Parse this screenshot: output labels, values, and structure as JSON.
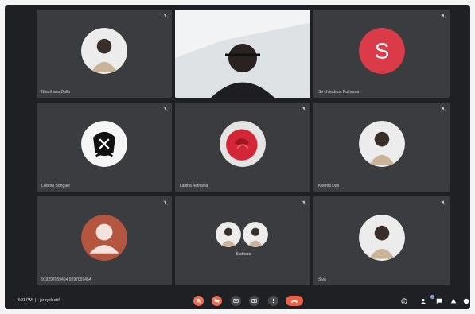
{
  "meeting": {
    "time": "3:01 PM",
    "code": "jsr-ryck-abf"
  },
  "participants": [
    {
      "name": "Bharthana Dalla",
      "avatar": "profile-photo",
      "muted": true
    },
    {
      "name": "",
      "avatar": "live-video",
      "muted": false
    },
    {
      "name": "Sri chandana Pathrana",
      "avatar": "letter",
      "letter": "S",
      "avatar_color": "#d93b48",
      "muted": true
    },
    {
      "name": "Lokesh Bongale",
      "avatar": "logo-photo",
      "muted": true
    },
    {
      "name": "Lalitha Aathavia",
      "avatar": "rose-photo",
      "muted": true
    },
    {
      "name": "Keerthi Das",
      "avatar": "profile-photo",
      "muted": true
    },
    {
      "name": "919297059454 9297059454",
      "avatar": "default-silhouette",
      "avatar_color": "#b4553f",
      "muted": true
    },
    {
      "name": "",
      "avatar": "group",
      "muted": false
    },
    {
      "name": "Siva",
      "avatar": "profile-photo",
      "muted": true
    }
  ],
  "others_label": "5 others",
  "controls": {
    "mic": "mic-off-icon",
    "camera": "camera-off-icon",
    "captions": "captions-icon",
    "present": "present-screen-icon",
    "more": "more-options-icon",
    "leave": "end-call-icon"
  },
  "side": {
    "participants_count": "9"
  },
  "colors": {
    "tile": "#3b3c3f",
    "background": "#1f2023",
    "red_control": "#e86f54"
  }
}
